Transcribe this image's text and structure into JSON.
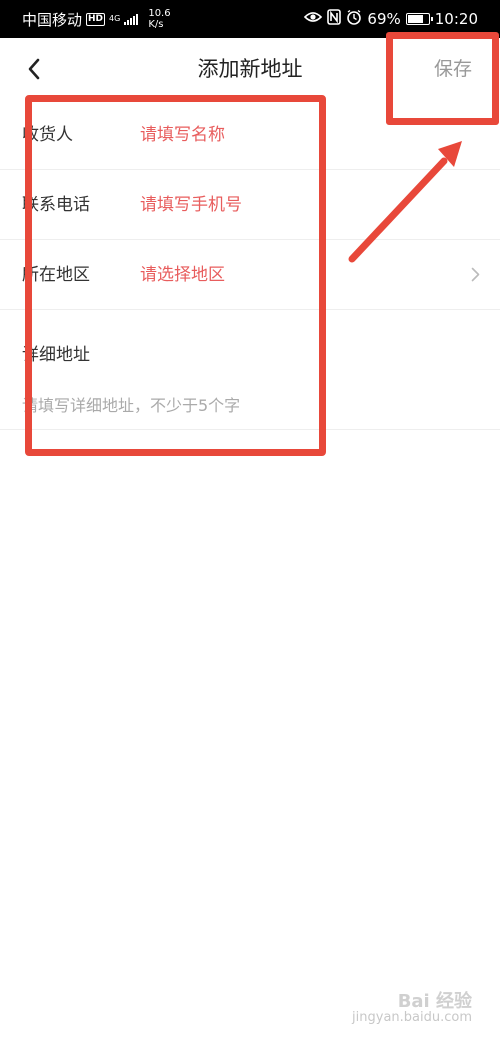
{
  "status_bar": {
    "carrier": "中国移动",
    "hd": "HD",
    "network": "4G",
    "speed_value": "10.6",
    "speed_unit": "K/s",
    "battery_percent": "69%",
    "battery_level": 0.69,
    "time": "10:20",
    "icons": [
      "eye-icon",
      "nfc-icon",
      "alarm-icon",
      "battery-icon",
      "signal-icon"
    ]
  },
  "nav": {
    "back_icon": "chevron-left-icon",
    "title": "添加新地址",
    "save_label": "保存"
  },
  "form": {
    "rows": [
      {
        "label": "收货人",
        "placeholder": "请填写名称"
      },
      {
        "label": "联系电话",
        "placeholder": "请填写手机号"
      },
      {
        "label": "所在地区",
        "placeholder": "请选择地区",
        "icon": "chevron-right-icon"
      }
    ],
    "detail": {
      "label": "详细地址",
      "placeholder": "请填写详细地址，不少于5个字"
    },
    "placeholder_color": "#e85d5d"
  },
  "annotations": {
    "color": "#e8483a"
  },
  "watermark": {
    "logo": "Bai 经验",
    "url": "jingyan.baidu.com"
  }
}
